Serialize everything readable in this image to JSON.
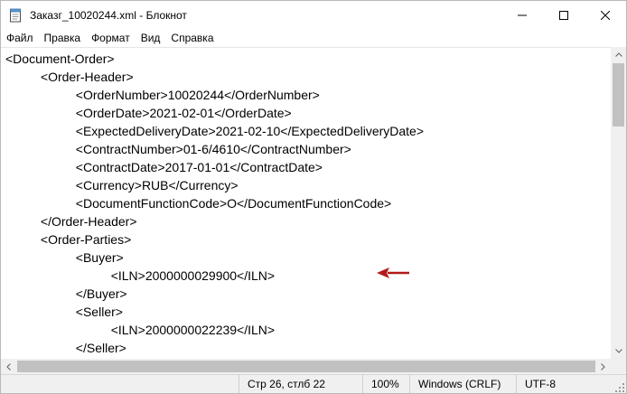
{
  "window": {
    "title": "Заказг_10020244.xml - Блокнот",
    "icons": {
      "app": "notepad-icon",
      "minimize": "minimize-icon",
      "maximize": "maximize-icon",
      "close": "close-icon"
    }
  },
  "menu": {
    "items": [
      "Файл",
      "Правка",
      "Формат",
      "Вид",
      "Справка"
    ]
  },
  "editor": {
    "lines": [
      "<Document-Order>",
      "          <Order-Header>",
      "                    <OrderNumber>10020244</OrderNumber>",
      "                    <OrderDate>2021-02-01</OrderDate>",
      "                    <ExpectedDeliveryDate>2021-02-10</ExpectedDeliveryDate>",
      "                    <ContractNumber>01-6/4610</ContractNumber>",
      "                    <ContractDate>2017-01-01</ContractDate>",
      "                    <Currency>RUB</Currency>",
      "                    <DocumentFunctionCode>O</DocumentFunctionCode>",
      "          </Order-Header>",
      "          <Order-Parties>",
      "                    <Buyer>",
      "                              <ILN>2000000029900</ILN>",
      "                    </Buyer>",
      "                    <Seller>",
      "                              <ILN>2000000022239</ILN>",
      "                    </Seller>"
    ],
    "annotation_color": "#b31b1b"
  },
  "status": {
    "position": "Стр 26, стлб 22",
    "zoom": "100%",
    "line_endings": "Windows (CRLF)",
    "encoding": "UTF-8"
  }
}
